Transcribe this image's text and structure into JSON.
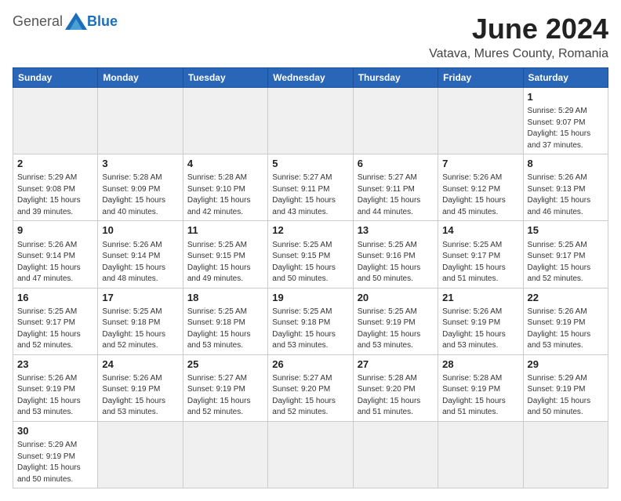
{
  "header": {
    "logo_general": "General",
    "logo_blue": "Blue",
    "month_title": "June 2024",
    "subtitle": "Vatava, Mures County, Romania"
  },
  "weekdays": [
    "Sunday",
    "Monday",
    "Tuesday",
    "Wednesday",
    "Thursday",
    "Friday",
    "Saturday"
  ],
  "weeks": [
    [
      {
        "day": "",
        "empty": true
      },
      {
        "day": "",
        "empty": true
      },
      {
        "day": "",
        "empty": true
      },
      {
        "day": "",
        "empty": true
      },
      {
        "day": "",
        "empty": true
      },
      {
        "day": "",
        "empty": true
      },
      {
        "day": "1",
        "info": "Sunrise: 5:29 AM\nSunset: 9:07 PM\nDaylight: 15 hours\nand 37 minutes."
      }
    ],
    [
      {
        "day": "2",
        "info": "Sunrise: 5:29 AM\nSunset: 9:08 PM\nDaylight: 15 hours\nand 39 minutes."
      },
      {
        "day": "3",
        "info": "Sunrise: 5:28 AM\nSunset: 9:09 PM\nDaylight: 15 hours\nand 40 minutes."
      },
      {
        "day": "4",
        "info": "Sunrise: 5:28 AM\nSunset: 9:10 PM\nDaylight: 15 hours\nand 42 minutes."
      },
      {
        "day": "5",
        "info": "Sunrise: 5:27 AM\nSunset: 9:11 PM\nDaylight: 15 hours\nand 43 minutes."
      },
      {
        "day": "6",
        "info": "Sunrise: 5:27 AM\nSunset: 9:11 PM\nDaylight: 15 hours\nand 44 minutes."
      },
      {
        "day": "7",
        "info": "Sunrise: 5:26 AM\nSunset: 9:12 PM\nDaylight: 15 hours\nand 45 minutes."
      },
      {
        "day": "8",
        "info": "Sunrise: 5:26 AM\nSunset: 9:13 PM\nDaylight: 15 hours\nand 46 minutes."
      }
    ],
    [
      {
        "day": "9",
        "info": "Sunrise: 5:26 AM\nSunset: 9:14 PM\nDaylight: 15 hours\nand 47 minutes."
      },
      {
        "day": "10",
        "info": "Sunrise: 5:26 AM\nSunset: 9:14 PM\nDaylight: 15 hours\nand 48 minutes."
      },
      {
        "day": "11",
        "info": "Sunrise: 5:25 AM\nSunset: 9:15 PM\nDaylight: 15 hours\nand 49 minutes."
      },
      {
        "day": "12",
        "info": "Sunrise: 5:25 AM\nSunset: 9:15 PM\nDaylight: 15 hours\nand 50 minutes."
      },
      {
        "day": "13",
        "info": "Sunrise: 5:25 AM\nSunset: 9:16 PM\nDaylight: 15 hours\nand 50 minutes."
      },
      {
        "day": "14",
        "info": "Sunrise: 5:25 AM\nSunset: 9:17 PM\nDaylight: 15 hours\nand 51 minutes."
      },
      {
        "day": "15",
        "info": "Sunrise: 5:25 AM\nSunset: 9:17 PM\nDaylight: 15 hours\nand 52 minutes."
      }
    ],
    [
      {
        "day": "16",
        "info": "Sunrise: 5:25 AM\nSunset: 9:17 PM\nDaylight: 15 hours\nand 52 minutes."
      },
      {
        "day": "17",
        "info": "Sunrise: 5:25 AM\nSunset: 9:18 PM\nDaylight: 15 hours\nand 52 minutes."
      },
      {
        "day": "18",
        "info": "Sunrise: 5:25 AM\nSunset: 9:18 PM\nDaylight: 15 hours\nand 53 minutes."
      },
      {
        "day": "19",
        "info": "Sunrise: 5:25 AM\nSunset: 9:18 PM\nDaylight: 15 hours\nand 53 minutes."
      },
      {
        "day": "20",
        "info": "Sunrise: 5:25 AM\nSunset: 9:19 PM\nDaylight: 15 hours\nand 53 minutes."
      },
      {
        "day": "21",
        "info": "Sunrise: 5:26 AM\nSunset: 9:19 PM\nDaylight: 15 hours\nand 53 minutes."
      },
      {
        "day": "22",
        "info": "Sunrise: 5:26 AM\nSunset: 9:19 PM\nDaylight: 15 hours\nand 53 minutes."
      }
    ],
    [
      {
        "day": "23",
        "info": "Sunrise: 5:26 AM\nSunset: 9:19 PM\nDaylight: 15 hours\nand 53 minutes."
      },
      {
        "day": "24",
        "info": "Sunrise: 5:26 AM\nSunset: 9:19 PM\nDaylight: 15 hours\nand 53 minutes."
      },
      {
        "day": "25",
        "info": "Sunrise: 5:27 AM\nSunset: 9:19 PM\nDaylight: 15 hours\nand 52 minutes."
      },
      {
        "day": "26",
        "info": "Sunrise: 5:27 AM\nSunset: 9:20 PM\nDaylight: 15 hours\nand 52 minutes."
      },
      {
        "day": "27",
        "info": "Sunrise: 5:28 AM\nSunset: 9:20 PM\nDaylight: 15 hours\nand 51 minutes."
      },
      {
        "day": "28",
        "info": "Sunrise: 5:28 AM\nSunset: 9:19 PM\nDaylight: 15 hours\nand 51 minutes."
      },
      {
        "day": "29",
        "info": "Sunrise: 5:29 AM\nSunset: 9:19 PM\nDaylight: 15 hours\nand 50 minutes."
      }
    ],
    [
      {
        "day": "30",
        "info": "Sunrise: 5:29 AM\nSunset: 9:19 PM\nDaylight: 15 hours\nand 50 minutes."
      },
      {
        "day": "",
        "empty": true
      },
      {
        "day": "",
        "empty": true
      },
      {
        "day": "",
        "empty": true
      },
      {
        "day": "",
        "empty": true
      },
      {
        "day": "",
        "empty": true
      },
      {
        "day": "",
        "empty": true
      }
    ]
  ]
}
